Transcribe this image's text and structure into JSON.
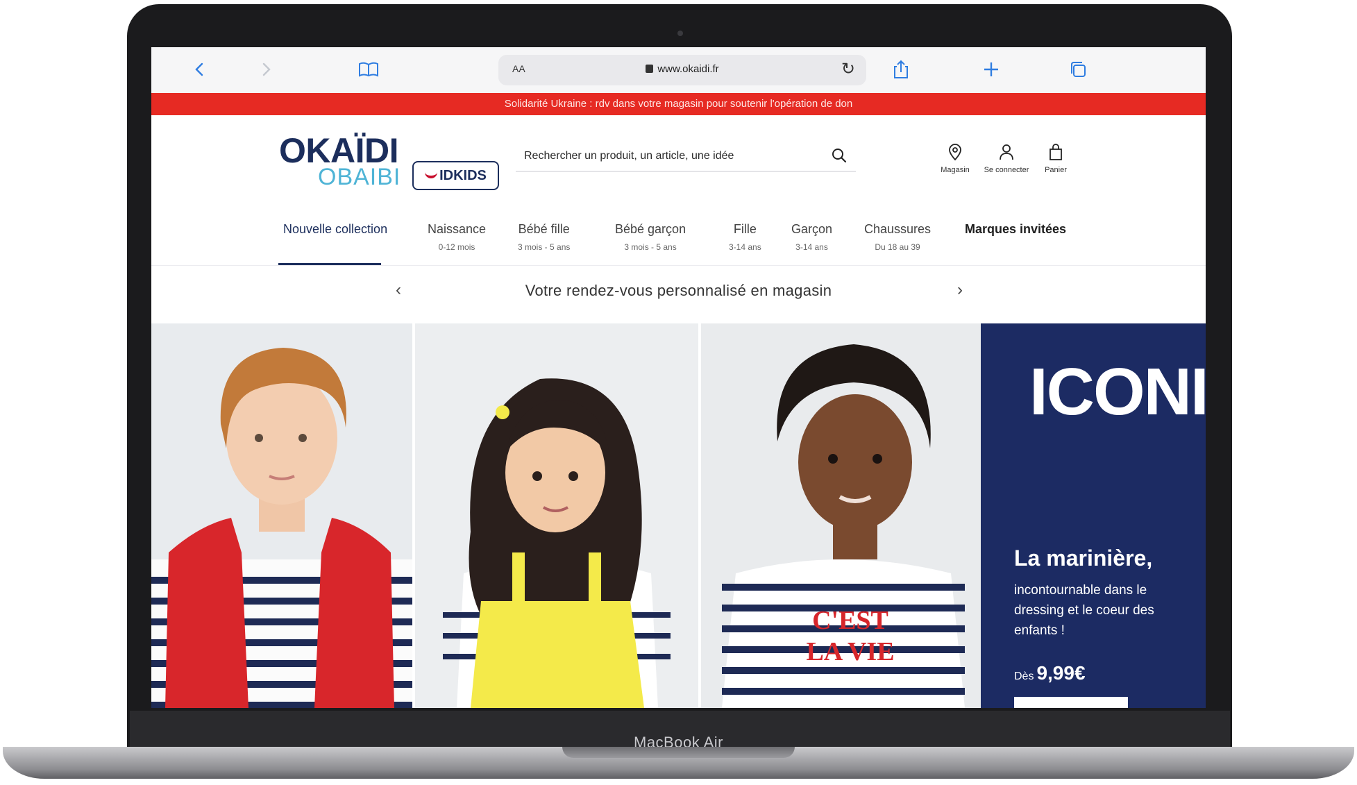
{
  "device": {
    "model_label": "MacBook Air"
  },
  "browser": {
    "url": "www.okaidi.fr",
    "text_size_label": "AA",
    "icons": [
      "back-icon",
      "forward-icon",
      "bookmarks-icon",
      "lock-icon",
      "reload-icon",
      "share-icon",
      "new-tab-icon",
      "tabs-icon"
    ]
  },
  "promo_banner": {
    "text": "Solidarité Ukraine : rdv dans votre magasin pour soutenir l'opération de don"
  },
  "header": {
    "logo_primary": "OKAÏDI",
    "logo_secondary": "OBAIBI",
    "logo_partner": "IDKIDS",
    "search": {
      "placeholder": "Rechercher un produit, un article, une idée"
    },
    "actions": [
      {
        "label": "Magasin",
        "icon": "store-locator-icon"
      },
      {
        "label": "Se connecter",
        "icon": "user-icon"
      },
      {
        "label": "Panier",
        "icon": "bag-icon"
      }
    ]
  },
  "nav": {
    "items": [
      {
        "label": "Nouvelle collection",
        "sub": ""
      },
      {
        "label": "Naissance",
        "sub": "0-12 mois"
      },
      {
        "label": "Bébé fille",
        "sub": "3 mois - 5 ans"
      },
      {
        "label": "Bébé garçon",
        "sub": "3 mois - 5 ans"
      },
      {
        "label": "Fille",
        "sub": "3-14 ans"
      },
      {
        "label": "Garçon",
        "sub": "3-14 ans"
      },
      {
        "label": "Chaussures",
        "sub": "Du 18 au 39"
      },
      {
        "label": "Marques invitées",
        "sub": ""
      }
    ],
    "active_index": 0
  },
  "carousel": {
    "text": "Votre rendez-vous personnalisé en magasin"
  },
  "hero": {
    "shirt_text_line1": "C'EST",
    "shirt_text_line2": "LA VIE",
    "promo": {
      "brand_word": "ICONIK",
      "title": "La marinière,",
      "description": "incontournable dans le dressing et le coeur des enfants !",
      "price_prefix": "Dès",
      "price": "9,99€"
    }
  },
  "colors": {
    "navy": "#1c2b63",
    "promo_red": "#e62a23",
    "accent_blue": "#2f7de1",
    "obaibi_blue": "#4fb4d6"
  }
}
